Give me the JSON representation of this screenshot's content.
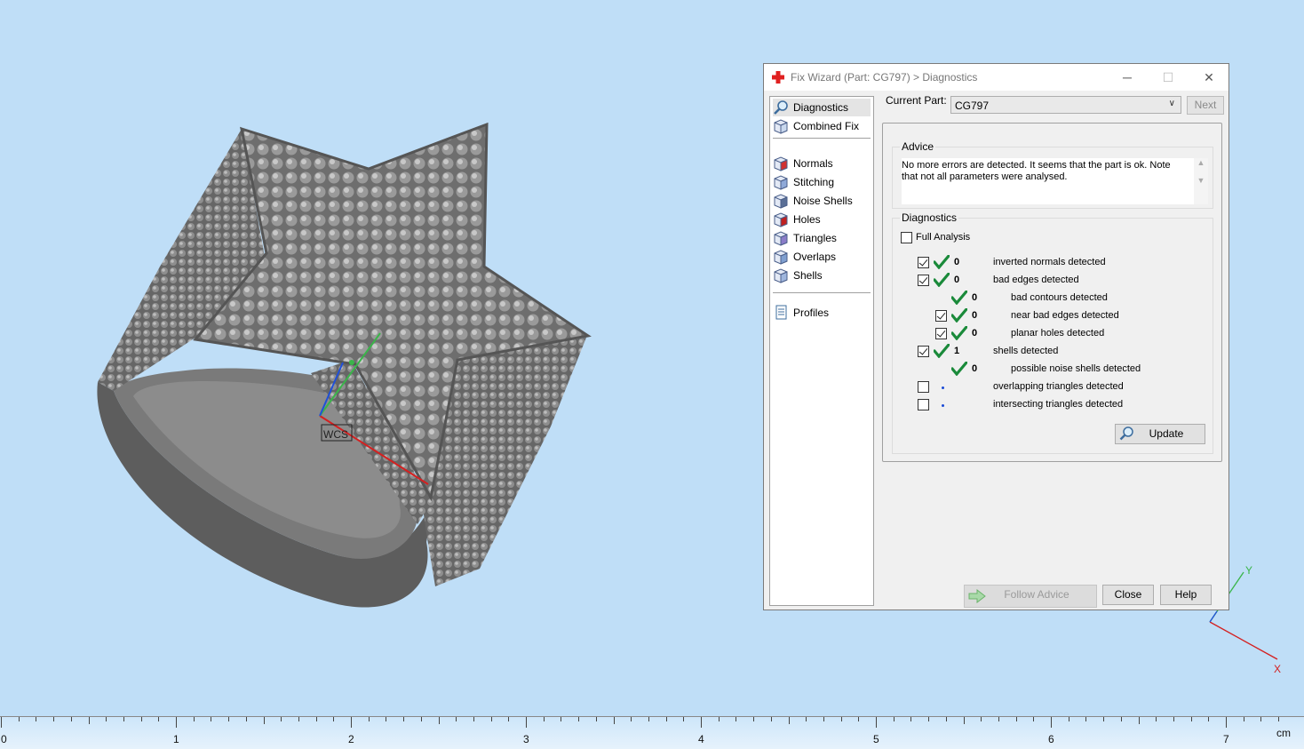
{
  "dialog": {
    "title": "Fix Wizard (Part: CG797) > Diagnostics",
    "window_buttons": {
      "minimize": "─",
      "maximize": "☐",
      "close": "✕"
    }
  },
  "nav": {
    "items": [
      {
        "label": "Diagnostics",
        "icon": "magnifier-icon"
      },
      {
        "label": "Combined Fix",
        "icon": "cube-icon"
      },
      {
        "label": "Normals",
        "icon": "normals-cube-icon"
      },
      {
        "label": "Stitching",
        "icon": "stitching-cube-icon"
      },
      {
        "label": "Noise Shells",
        "icon": "noise-shells-icon"
      },
      {
        "label": "Holes",
        "icon": "holes-cube-icon"
      },
      {
        "label": "Triangles",
        "icon": "triangles-cube-icon"
      },
      {
        "label": "Overlaps",
        "icon": "overlaps-cube-icon"
      },
      {
        "label": "Shells",
        "icon": "shells-cube-icon"
      },
      {
        "label": "Profiles",
        "icon": "document-icon"
      }
    ]
  },
  "part": {
    "label": "Current Part:",
    "value": "CG797",
    "next_label": "Next"
  },
  "advice": {
    "title": "Advice",
    "text": "No more errors are detected. It seems that the part is ok. Note that not all parameters were analysed."
  },
  "diagnostics": {
    "title": "Diagnostics",
    "full_analysis_label": "Full Analysis",
    "rows": [
      {
        "checkbox": true,
        "checked": true,
        "ok": true,
        "count": "0",
        "label": "inverted normals detected",
        "indent": 0
      },
      {
        "checkbox": true,
        "checked": true,
        "ok": true,
        "count": "0",
        "label": "bad edges detected",
        "indent": 0
      },
      {
        "checkbox": false,
        "checked": false,
        "ok": true,
        "count": "0",
        "label": "bad contours detected",
        "indent": 1
      },
      {
        "checkbox": true,
        "checked": true,
        "ok": true,
        "count": "0",
        "label": "near bad edges detected",
        "indent": 1
      },
      {
        "checkbox": true,
        "checked": true,
        "ok": true,
        "count": "0",
        "label": "planar holes detected",
        "indent": 1
      },
      {
        "checkbox": true,
        "checked": true,
        "ok": true,
        "count": "1",
        "label": "shells detected",
        "indent": 0
      },
      {
        "checkbox": false,
        "checked": false,
        "ok": true,
        "count": "0",
        "label": "possible noise shells detected",
        "indent": 1
      },
      {
        "checkbox": true,
        "checked": false,
        "ok": false,
        "count": "",
        "label": "overlapping triangles detected",
        "indent": 0
      },
      {
        "checkbox": true,
        "checked": false,
        "ok": false,
        "count": "",
        "label": "intersecting triangles detected",
        "indent": 0
      }
    ],
    "update_label": "Update"
  },
  "footer": {
    "follow_advice": "Follow Advice",
    "close": "Close",
    "help": "Help"
  },
  "viewport": {
    "wcs_label": "WCS",
    "axis_y": "Y",
    "axis_x": "X"
  },
  "ruler": {
    "labels": [
      "0",
      "1",
      "2",
      "3",
      "4",
      "5",
      "6",
      "7"
    ],
    "unit": "cm"
  },
  "colors": {
    "background": "#bfdef7",
    "check_green": "#1a8a3a",
    "app_red": "#e02020"
  }
}
